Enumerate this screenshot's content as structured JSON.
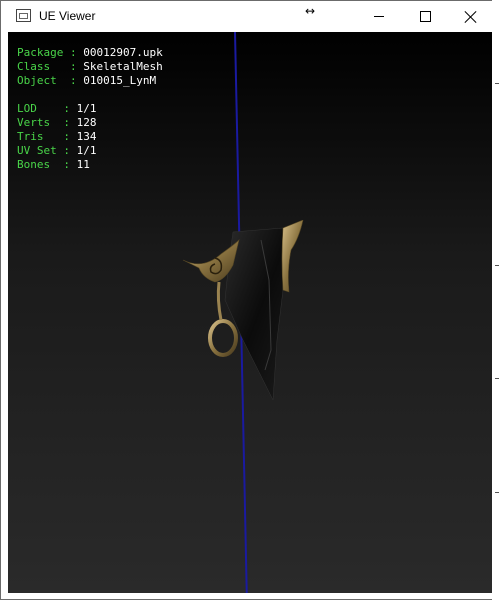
{
  "window": {
    "title": "UE Viewer"
  },
  "info_panel": {
    "package_label": "Package",
    "package_value": "00012907.upk",
    "class_label": "Class",
    "class_value": "SkeletalMesh",
    "object_label": "Object",
    "object_value": "010015_LynM",
    "lod_label": "LOD",
    "lod_value": "1/1",
    "verts_label": "Verts",
    "verts_value": "128",
    "tris_label": "Tris",
    "tris_value": "134",
    "uvset_label": "UV Set",
    "uvset_value": "1/1",
    "bones_label": "Bones",
    "bones_value": "11"
  },
  "colors": {
    "label_green": "#49d549",
    "value_white": "#ffffff",
    "axis_blue": "#1a1aa0",
    "mesh_black": "#0b0b0b",
    "mesh_gold": "#a08a52"
  },
  "icons": {
    "app": "app-icon",
    "resize": "resize-arrows-icon",
    "minimize": "minimize-icon",
    "maximize": "maximize-icon",
    "close": "close-icon"
  }
}
